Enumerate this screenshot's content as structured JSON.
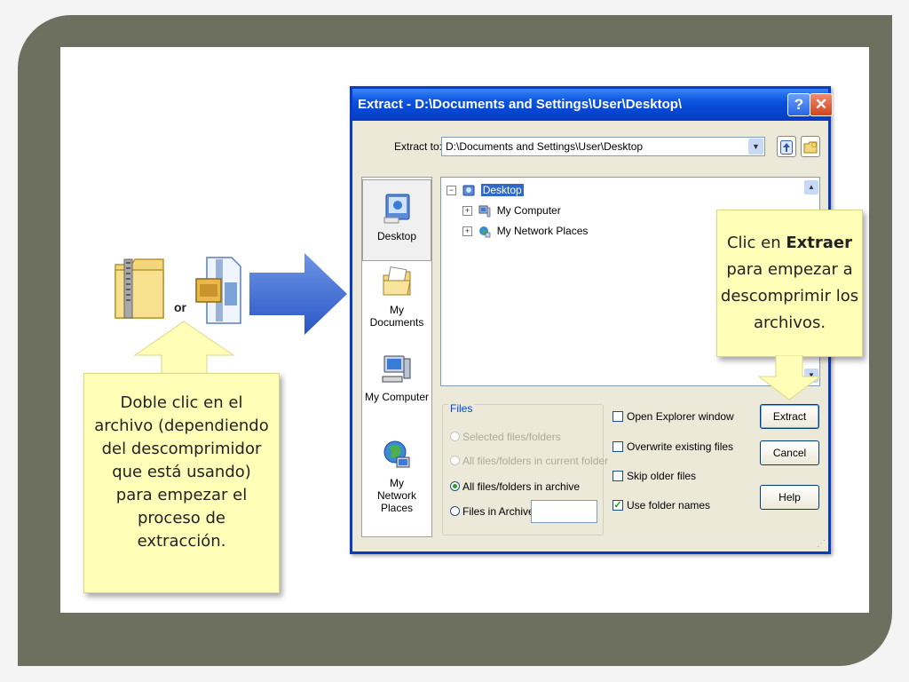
{
  "slide": {
    "or_label": "or",
    "callout_left": [
      "Doble clic en el",
      "archivo (dependiendo",
      "del descomprimidor",
      "que está usando)",
      "para empezar el",
      "proceso de",
      "extracción."
    ],
    "callout_right": {
      "line1_prefix": "Clic en ",
      "line1_bold": "Extraer",
      "lines": [
        "para empezar a",
        "descomprimir los",
        "archivos."
      ]
    }
  },
  "dialog": {
    "title": "Extract - D:\\Documents and Settings\\User\\Desktop\\",
    "help_button": "?",
    "close_button": "✕",
    "extract_to_label": "Extract to:",
    "extract_to_value": "D:\\Documents and Settings\\User\\Desktop",
    "places": [
      "Desktop",
      "My Documents",
      "My Computer",
      "My Network Places"
    ],
    "tree": [
      {
        "label": "Desktop",
        "expander": "−",
        "selected": true
      },
      {
        "label": "My Computer",
        "expander": "+",
        "selected": false
      },
      {
        "label": "My Network Places",
        "expander": "+",
        "selected": false
      }
    ],
    "files_group": {
      "title": "Files",
      "options": [
        {
          "label": "Selected files/folders",
          "enabled": false,
          "checked": false
        },
        {
          "label": "All files/folders in current folder",
          "enabled": false,
          "checked": false
        },
        {
          "label": "All files/folders in archive",
          "enabled": true,
          "checked": true
        },
        {
          "label": "Files in Archive:",
          "enabled": true,
          "checked": false
        }
      ],
      "files_in_archive_value": ""
    },
    "checkboxes": [
      {
        "label": "Open Explorer window",
        "checked": false
      },
      {
        "label": "Overwrite existing files",
        "checked": false
      },
      {
        "label": "Skip older files",
        "checked": false
      },
      {
        "label": "Use folder names",
        "checked": true
      }
    ],
    "buttons": {
      "extract": "Extract",
      "cancel": "Cancel",
      "help": "Help"
    }
  },
  "colors": {
    "frame": "#6d705f",
    "callout": "#ffffb8",
    "titlebar": "#0a52e0",
    "arrow": "#3b6fd8"
  }
}
